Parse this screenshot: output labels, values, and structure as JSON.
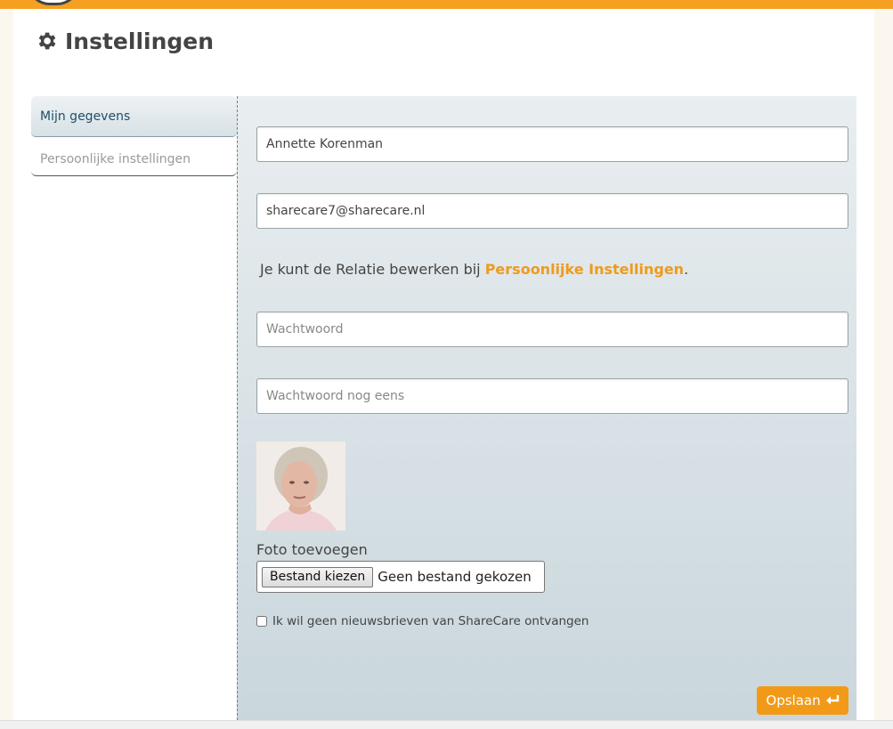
{
  "header": {
    "title": "Instellingen",
    "icon": "gear-icon"
  },
  "sidebar": {
    "items": [
      {
        "label": "Mijn gegevens",
        "active": true
      },
      {
        "label": "Persoonlijke instellingen",
        "active": false
      }
    ]
  },
  "form": {
    "name_value": "Annette Korenman",
    "email_value": "sharecare7@sharecare.nl",
    "info_text": "Je kunt de Relatie bewerken bij ",
    "info_link": "Persoonlijke Instellingen",
    "info_end": ".",
    "password_placeholder": "Wachtwoord",
    "password_repeat_placeholder": "Wachtwoord nog eens",
    "photo_label": "Foto toevoegen",
    "file_button": "Bestand kiezen",
    "file_status": "Geen bestand gekozen",
    "newsletter_label": "Ik wil geen nieuwsbrieven van ShareCare ontvangen",
    "newsletter_checked": false,
    "save_label": "Opslaan"
  },
  "colors": {
    "accent": "#f29a17",
    "topbar": "#f5a020",
    "link": "#ef9a1c",
    "sidebar_active": "#1f4e6b"
  }
}
